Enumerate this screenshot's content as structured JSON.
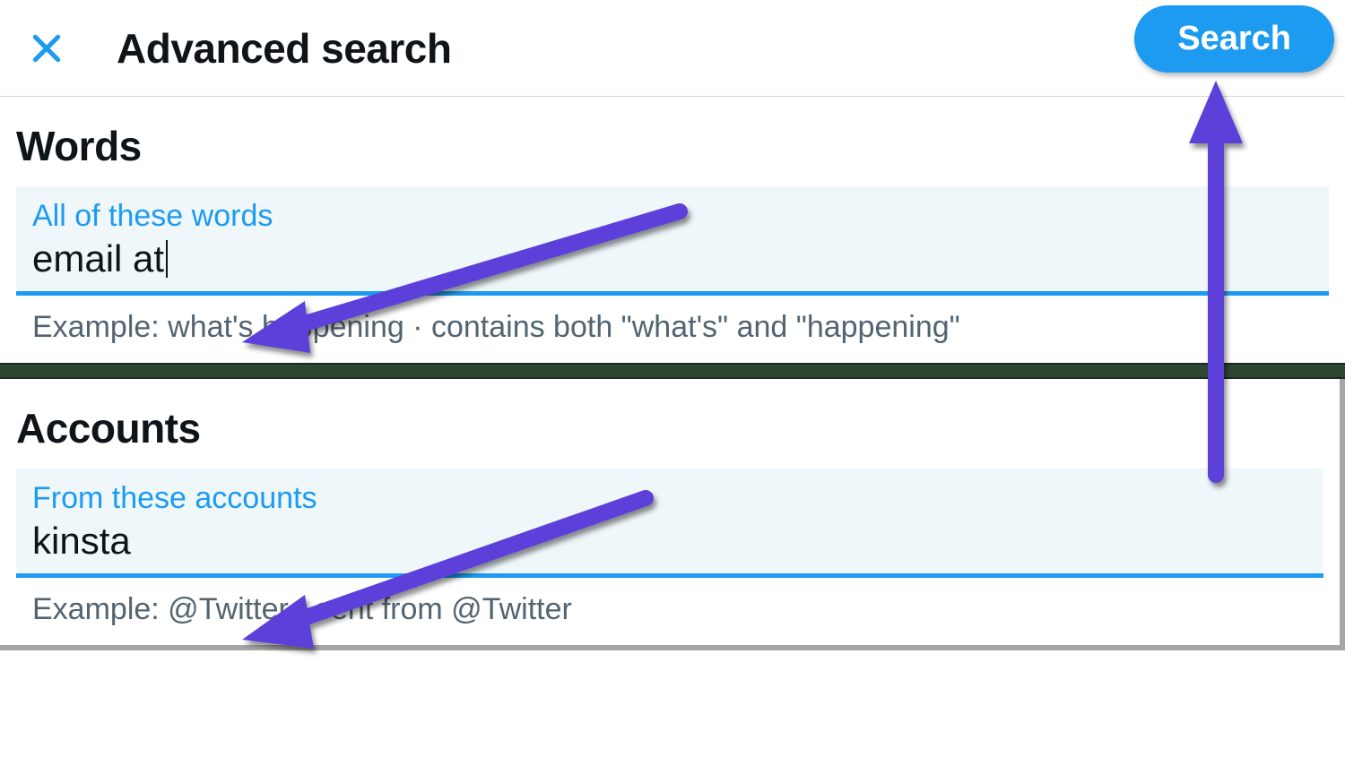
{
  "header": {
    "title": "Advanced search",
    "search_button": "Search",
    "close_icon": "x"
  },
  "sections": {
    "words": {
      "heading": "Words",
      "field_label": "All of these words",
      "field_value": "email at",
      "example": "Example: what's happening · contains both \"what's\" and \"happening\""
    },
    "accounts": {
      "heading": "Accounts",
      "field_label": "From these accounts",
      "field_value": "kinsta",
      "example": "Example: @Twitter · sent from @Twitter"
    }
  },
  "colors": {
    "accent": "#1d9bf0",
    "annotation_arrow": "#5b3fd9",
    "text_muted": "#536471",
    "field_bg": "#eff7fb"
  },
  "annotation": {
    "type": "purple-arrows",
    "targets": [
      "words-input",
      "accounts-input",
      "search-button"
    ]
  }
}
